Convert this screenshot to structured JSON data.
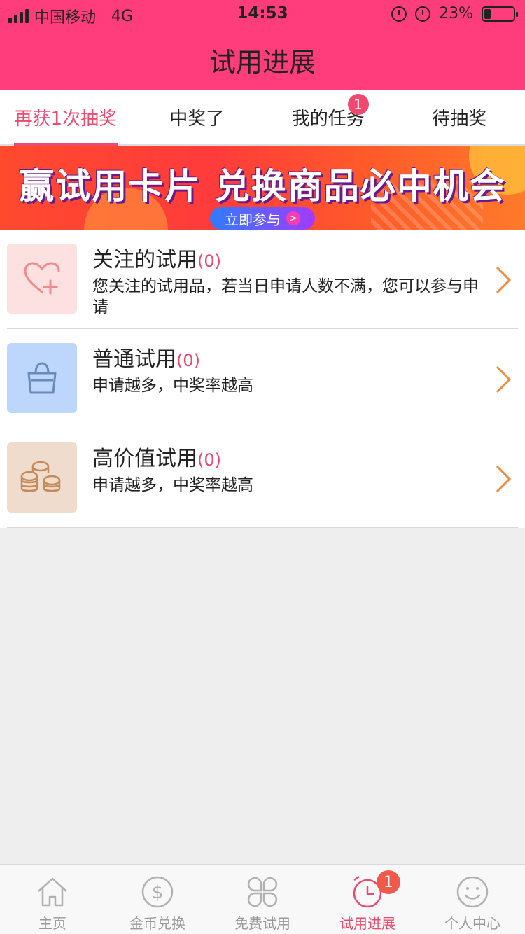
{
  "status_bar": {
    "carrier": "中国移动",
    "network": "4G",
    "time": "14:53",
    "battery_percent": "23%",
    "battery_level": 0.23
  },
  "header": {
    "title": "试用进展"
  },
  "tabs": [
    {
      "label": "再获1次抽奖",
      "active": true
    },
    {
      "label": "中奖了",
      "active": false
    },
    {
      "label": "我的任务",
      "active": false,
      "badge": "1"
    },
    {
      "label": "待抽奖",
      "active": false
    }
  ],
  "banner": {
    "headline": "赢试用卡片 兑换商品必中机会",
    "button_label": "立即参与",
    "button_arrow": ">"
  },
  "list": [
    {
      "title": "关注的试用",
      "count": "(0)",
      "desc": "您关注的试用品，若当日申请人数不满，您可以参与申请",
      "icon": "heart-plus-icon",
      "icon_bg": "#fde0e0",
      "icon_color": "#f28a8a"
    },
    {
      "title": "普通试用",
      "count": "(0)",
      "desc": "申请越多，中奖率越高",
      "icon": "shopping-bag-icon",
      "icon_bg": "#bcd7fb",
      "icon_color": "#6a8ab8"
    },
    {
      "title": "高价值试用",
      "count": "(0)",
      "desc": "申请越多，中奖率越高",
      "icon": "coins-icon",
      "icon_bg": "#efdccd",
      "icon_color": "#c48a5a"
    }
  ],
  "bottom_nav": [
    {
      "label": "主页",
      "icon": "home-icon",
      "active": false
    },
    {
      "label": "金币兑换",
      "icon": "dollar-coin-icon",
      "active": false
    },
    {
      "label": "免费试用",
      "icon": "clover-icon",
      "active": false
    },
    {
      "label": "试用进展",
      "icon": "alarm-clock-icon",
      "active": true,
      "badge": "1"
    },
    {
      "label": "个人中心",
      "icon": "smiley-icon",
      "active": false
    }
  ],
  "colors": {
    "brand_pink": "#ff3d7c",
    "active_text": "#ee4a6e",
    "chevron": "#f08a3c",
    "inactive_nav": "#999999"
  }
}
